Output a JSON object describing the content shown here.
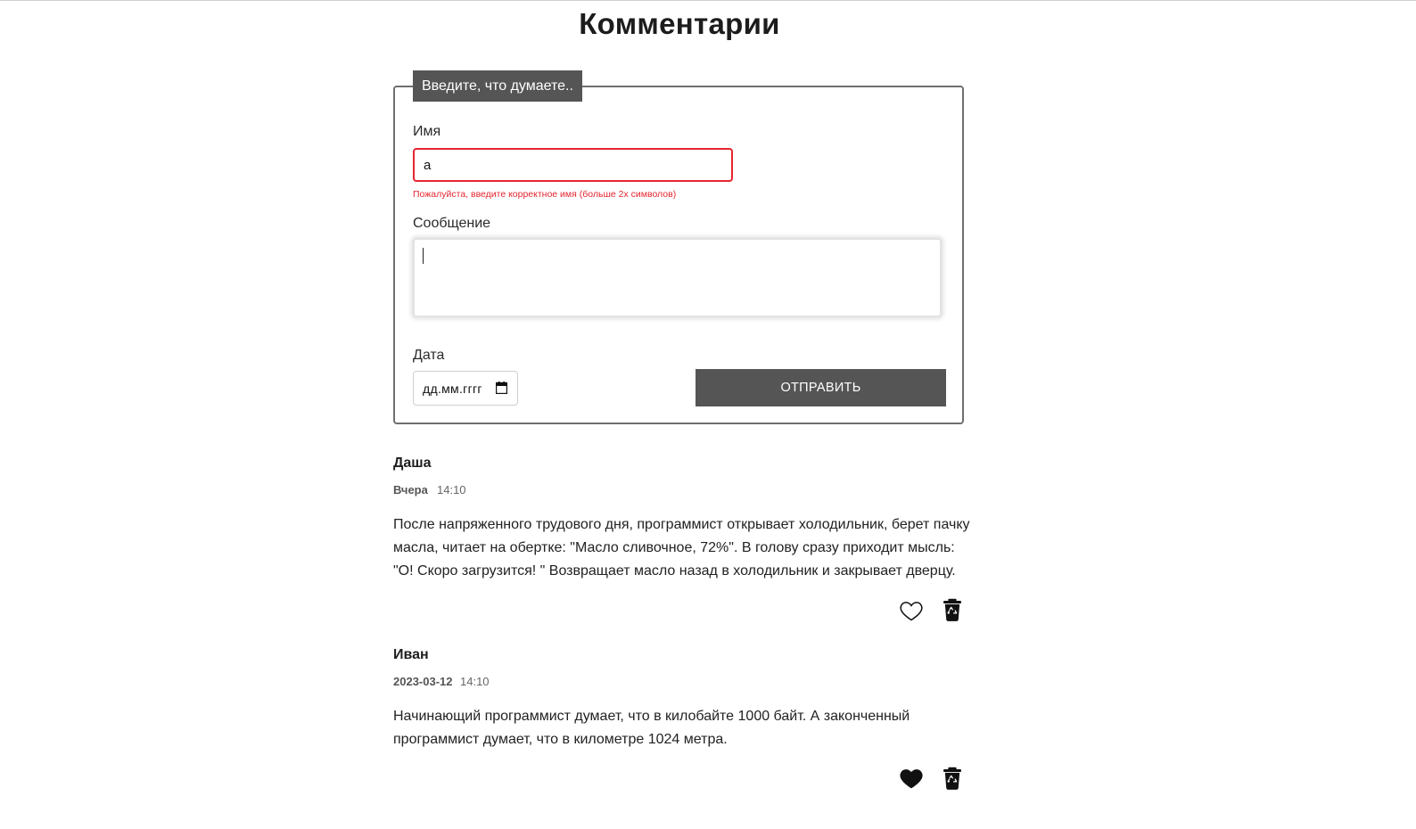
{
  "page": {
    "title": "Комментарии"
  },
  "form": {
    "legend": "Введите, что думаете..",
    "name_label": "Имя",
    "name_value": "а",
    "name_error": "Пожалуйста, введите корректное имя (больше 2х символов)",
    "message_label": "Сообщение",
    "message_value": "",
    "date_label": "Дата",
    "date_placeholder": "дд.мм.гггг",
    "submit_label": "ОТПРАВИТЬ"
  },
  "comments": [
    {
      "author": "Даша",
      "date": "Вчера",
      "time": "14:10",
      "text": "После напряженного трудового дня, программист открывает холодильник, берет пачку масла, читает на обертке: \"Масло сливочное, 72%\". В голову сразу приходит мысль: \"О! Скоро загрузится! \" Возвращает масло назад в холодильник и закрывает дверцу.",
      "liked": false,
      "like_icon": "heart-outline-icon",
      "delete_icon": "trash-recycle-icon"
    },
    {
      "author": "Иван",
      "date": "2023-03-12",
      "time": "14:10",
      "text": "Начинающий программист думает, что в килобайте 1000 байт. А законченный программист думает, что в километре 1024 метра.",
      "liked": true,
      "like_icon": "heart-filled-icon",
      "delete_icon": "trash-recycle-icon"
    }
  ],
  "colors": {
    "accent": "#555555",
    "error": "#e5262f",
    "border": "#6f6f6f"
  }
}
